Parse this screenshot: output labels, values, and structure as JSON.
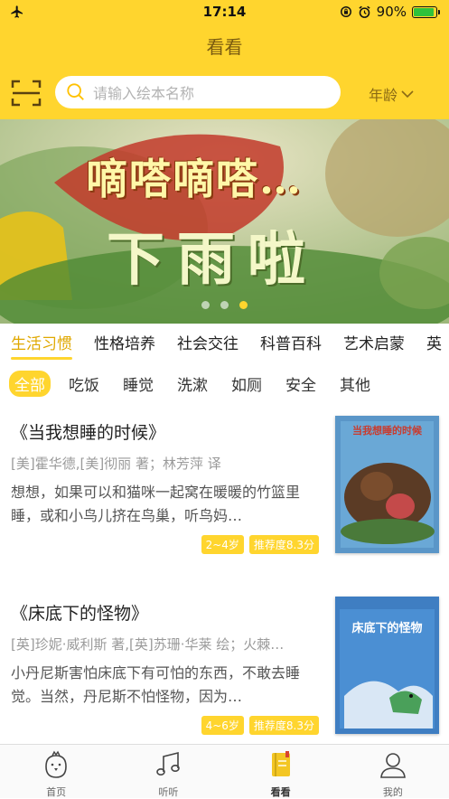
{
  "status": {
    "time": "17:14",
    "battery": "90%",
    "battery_level": 0.9
  },
  "nav": {
    "title": "看看"
  },
  "search": {
    "placeholder": "请输入绘本名称",
    "age_label": "年龄"
  },
  "banner": {
    "line1": "嘀嗒嘀嗒…",
    "line2": "下雨啦",
    "active_dot": 2,
    "dot_count": 3
  },
  "category_tabs": [
    {
      "label": "生活习惯",
      "active": true
    },
    {
      "label": "性格培养",
      "active": false
    },
    {
      "label": "社会交往",
      "active": false
    },
    {
      "label": "科普百科",
      "active": false
    },
    {
      "label": "艺术启蒙",
      "active": false
    },
    {
      "label": "英",
      "active": false
    }
  ],
  "filters": [
    {
      "label": "全部",
      "active": true
    },
    {
      "label": "吃饭",
      "active": false
    },
    {
      "label": "睡觉",
      "active": false
    },
    {
      "label": "洗漱",
      "active": false
    },
    {
      "label": "如厕",
      "active": false
    },
    {
      "label": "安全",
      "active": false
    },
    {
      "label": "其他",
      "active": false
    }
  ],
  "books": [
    {
      "title": "《当我想睡的时候》",
      "author": "[美]霍华德,[美]彻丽 著；林芳萍 译",
      "desc": "想想，如果可以和猫咪一起窝在暖暖的竹篮里睡，或和小鸟儿挤在鸟巢，听鸟妈…",
      "age_tag": "2~4岁",
      "score_tag": "推荐度8.3分",
      "cover_title": "当我想睡的时候"
    },
    {
      "title": "《床底下的怪物》",
      "author": "[英]珍妮·威利斯 著,[英]苏珊·华莱 绘；火棘…",
      "desc": "小丹尼斯害怕床底下有可怕的东西，不敢去睡觉。当然，丹尼斯不怕怪物，因为…",
      "age_tag": "4~6岁",
      "score_tag": "推荐度8.3分",
      "cover_title": "床底下的怪物"
    }
  ],
  "tab_bar": [
    {
      "label": "首页",
      "icon": "chick-icon",
      "active": false
    },
    {
      "label": "听听",
      "icon": "music-note-icon",
      "active": false
    },
    {
      "label": "看看",
      "icon": "book-icon",
      "active": true
    },
    {
      "label": "我的",
      "icon": "person-icon",
      "active": false
    }
  ],
  "colors": {
    "accent": "#ffd52e",
    "tab_active": "#e0a800"
  }
}
